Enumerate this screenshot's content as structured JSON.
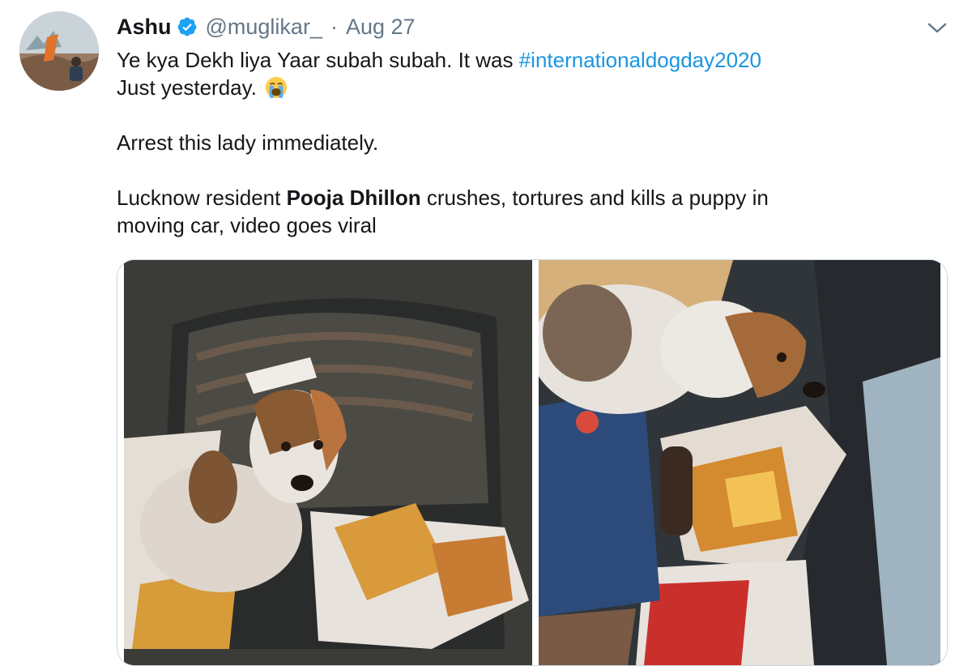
{
  "tweet": {
    "author_name": "Ashu",
    "handle": "@muglikar_",
    "separator": "·",
    "date": "Aug 27",
    "text_line1_prefix": "Ye kya Dekh liya Yaar subah subah. It was ",
    "hashtag": "#internationaldogday2020",
    "text_line2": "Just yesterday.",
    "emoji": "loudly-crying-face",
    "text_line3": "Arrest this lady immediately.",
    "text_line4_prefix": "Lucknow resident ",
    "text_line4_bold": "Pooja Dhillon",
    "text_line4_suffix": " crushes, tortures and kills a puppy in",
    "text_line5": "moving car, video goes viral"
  },
  "icons": {
    "verified": "verified-badge-icon",
    "more": "chevron-down-icon"
  },
  "media": {
    "count": 2
  },
  "colors": {
    "text": "#14171a",
    "secondary": "#657786",
    "link": "#1b95e0",
    "verified": "#1da1f2",
    "border": "#ccd6dd"
  }
}
